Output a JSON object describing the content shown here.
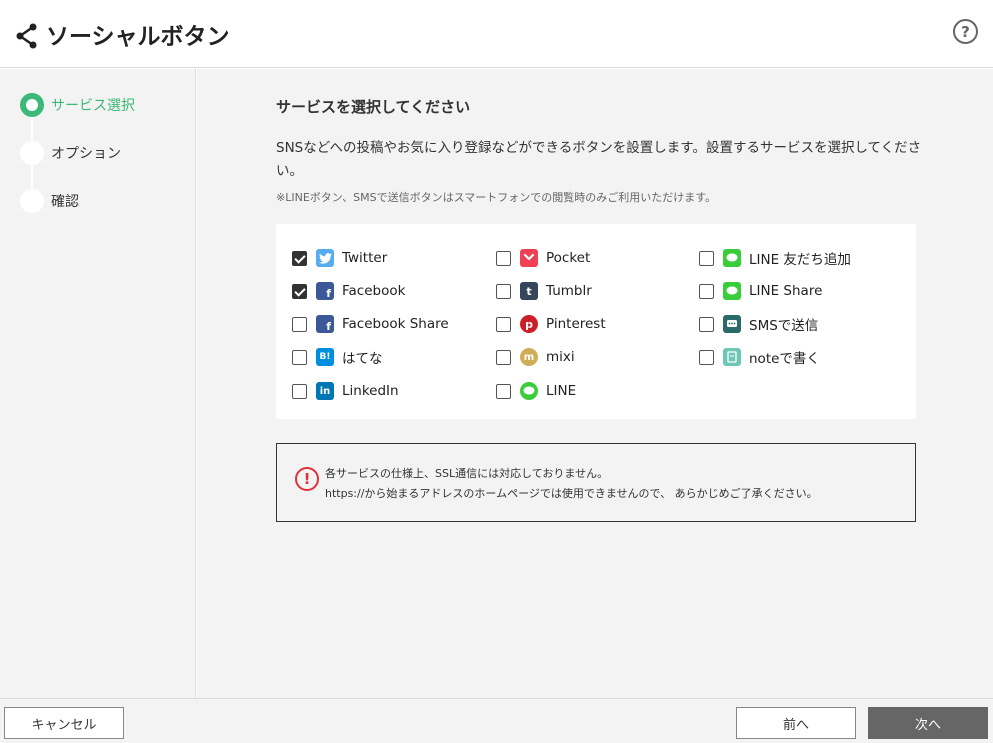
{
  "header": {
    "title": "ソーシャルボタン",
    "help_glyph": "?"
  },
  "sidebar": {
    "steps": [
      {
        "label": "サービス選択",
        "active": true
      },
      {
        "label": "オプション",
        "active": false
      },
      {
        "label": "確認",
        "active": false
      }
    ]
  },
  "main": {
    "section_title": "サービスを選択してください",
    "description": "SNSなどへの投稿やお気に入り登録などができるボタンを設置します。設置するサービスを選択してください。",
    "note": "※LINEボタン、SMSで送信ボタンはスマートフォンでの閲覧時のみご利用いただけます。",
    "services": [
      {
        "label": "Twitter",
        "checked": true,
        "icon": "twitter-icon",
        "color": "#55acee"
      },
      {
        "label": "Facebook",
        "checked": true,
        "icon": "facebook-icon",
        "color": "#3b5998"
      },
      {
        "label": "Facebook Share",
        "checked": false,
        "icon": "facebook-icon",
        "color": "#3b5998"
      },
      {
        "label": "はてな",
        "checked": false,
        "icon": "hatena-icon",
        "color": "#008fde"
      },
      {
        "label": "LinkedIn",
        "checked": false,
        "icon": "linkedin-icon",
        "color": "#0077b5"
      },
      {
        "label": "Pocket",
        "checked": false,
        "icon": "pocket-icon",
        "color": "#ef4056"
      },
      {
        "label": "Tumblr",
        "checked": false,
        "icon": "tumblr-icon",
        "color": "#35465c"
      },
      {
        "label": "Pinterest",
        "checked": false,
        "icon": "pinterest-icon",
        "color": "#cb2027"
      },
      {
        "label": "mixi",
        "checked": false,
        "icon": "mixi-icon",
        "color": "#d1ad5a"
      },
      {
        "label": "LINE",
        "checked": false,
        "icon": "line-icon",
        "color": "#3acd3a"
      },
      {
        "label": "LINE 友だち追加",
        "checked": false,
        "icon": "line-icon",
        "color": "#3acd3a"
      },
      {
        "label": "LINE Share",
        "checked": false,
        "icon": "line-icon",
        "color": "#3acd3a"
      },
      {
        "label": "SMSで送信",
        "checked": false,
        "icon": "sms-icon",
        "color": "#2b6a6a"
      },
      {
        "label": "noteで書く",
        "checked": false,
        "icon": "note-icon",
        "color": "#6fc7b8"
      }
    ],
    "warning": {
      "line1": "各サービスの仕様上、SSL通信には対応しておりません。",
      "line2": "https://から始まるアドレスのホームページでは使用できませんので、 あらかじめご了承ください。",
      "glyph": "!"
    }
  },
  "footer": {
    "cancel_label": "キャンセル",
    "prev_label": "前へ",
    "next_label": "次へ"
  },
  "colors": {
    "accent": "#3cb878",
    "warning": "#e0303a",
    "next_button": "#666666"
  }
}
